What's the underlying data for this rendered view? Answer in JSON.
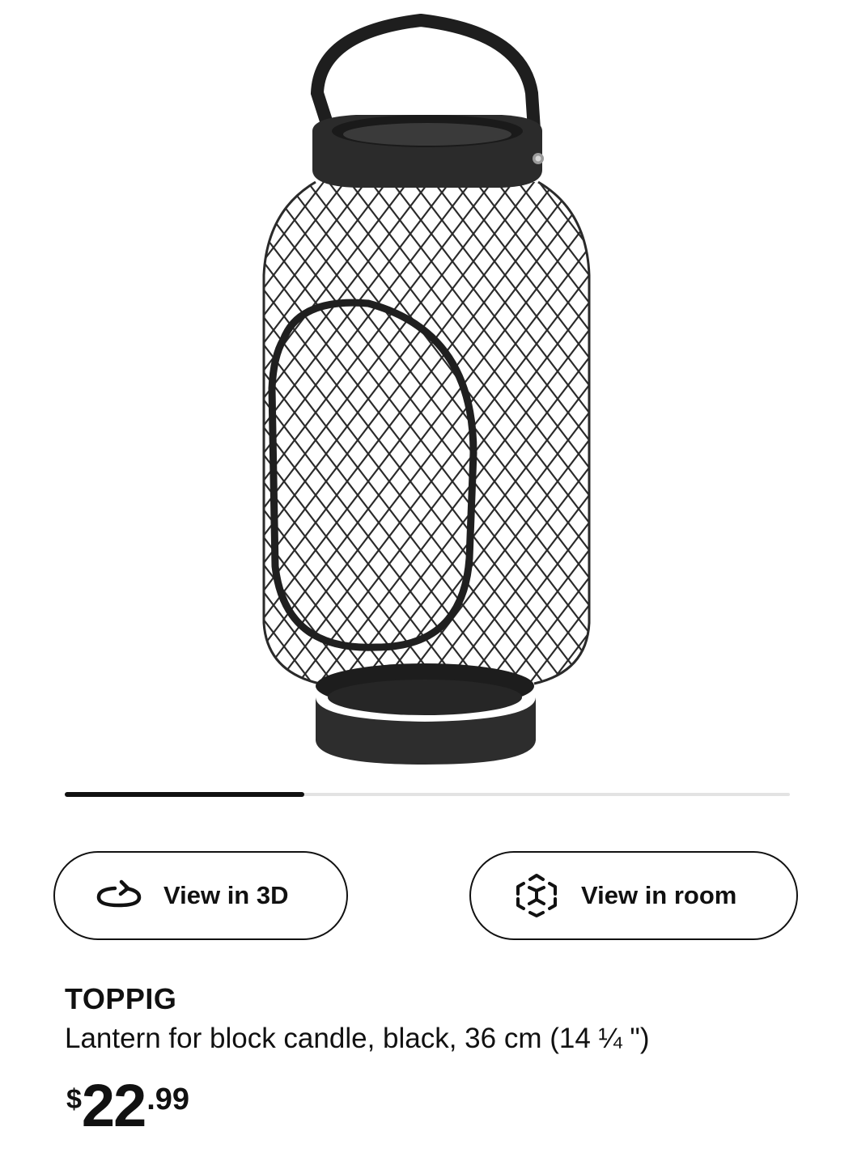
{
  "product_image": {
    "icon": "lantern-product-image"
  },
  "carousel": {
    "progress": 0.33
  },
  "actions": {
    "view_3d": {
      "label": "View in 3D",
      "icon": "rotate-3d-icon"
    },
    "view_room": {
      "label": "View in room",
      "icon": "augmented-reality-cube-icon"
    }
  },
  "product": {
    "name": "TOPPIG",
    "description": "Lantern for block candle, black, 36 cm (14 ¼ \")",
    "price": {
      "currency": "$",
      "integer": "22",
      "decimal": ".99"
    }
  },
  "colors": {
    "text": "#111111",
    "track": "#e3e3e3",
    "lantern": "#2a2a2a"
  }
}
